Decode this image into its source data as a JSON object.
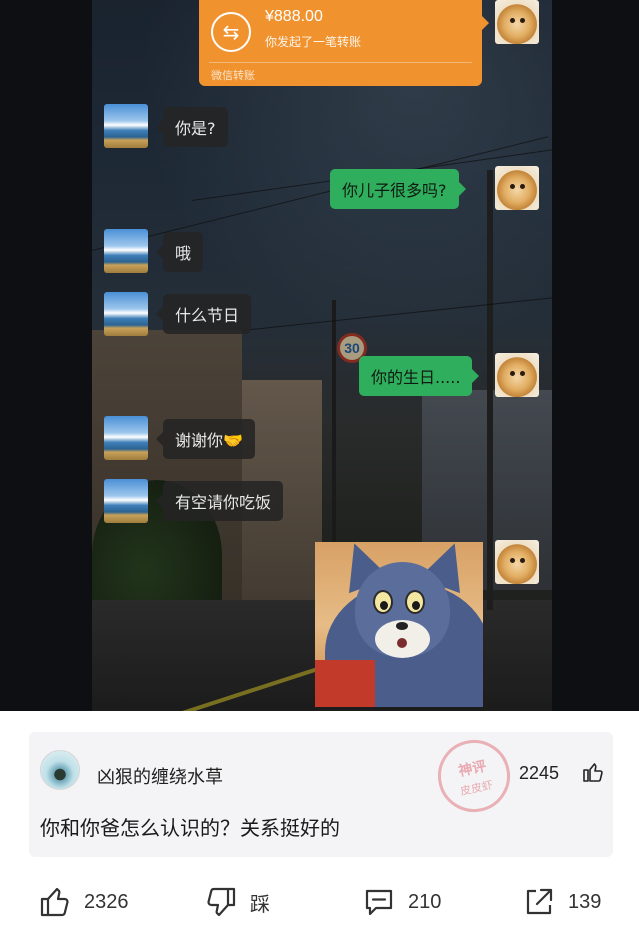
{
  "chat": {
    "transfer": {
      "icon": "transfer-arrows-icon",
      "amount": "¥888.00",
      "desc": "你发起了一笔转账",
      "footer": "微信转账"
    },
    "messages": [
      {
        "side": "left",
        "text": "你是?"
      },
      {
        "side": "right",
        "text": "你儿子很多吗?"
      },
      {
        "side": "left",
        "text": "哦"
      },
      {
        "side": "left",
        "text": "什么节日"
      },
      {
        "side": "right",
        "text": "你的生日....."
      },
      {
        "side": "left",
        "text": "谢谢你🤝"
      },
      {
        "side": "left",
        "text": "有空请你吃饭"
      }
    ],
    "speed_sign": "30",
    "sticker": "tom-cat-sticker"
  },
  "comment": {
    "author": "凶狠的缠绕水草",
    "likes": "2245",
    "text": "你和你爸怎么认识的？关系挺好的",
    "stamp_line1": "神评",
    "stamp_line2": "皮皮虾"
  },
  "actions": {
    "like_count": "2326",
    "dislike_label": "踩",
    "comment_count": "210",
    "share_count": "139"
  },
  "colors": {
    "transfer_orange": "#f0932f",
    "bubble_green": "#2fae5d",
    "bubble_dark": "#242424",
    "stamp_pink": "#e07882"
  }
}
